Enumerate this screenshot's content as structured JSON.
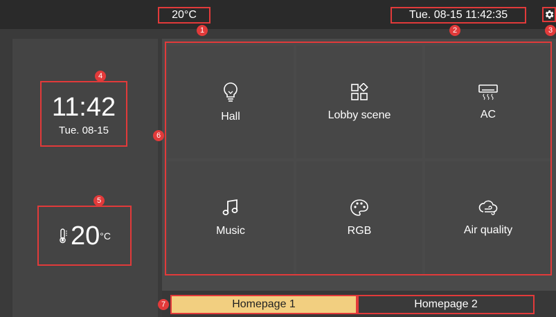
{
  "topbar": {
    "temperature": "20°C",
    "datetime": "Tue. 08-15 11:42:35"
  },
  "badges": [
    "1",
    "2",
    "3",
    "4",
    "5",
    "6",
    "7"
  ],
  "clock": {
    "time": "11:42",
    "date": "Tue. 08-15"
  },
  "weather": {
    "value": "20",
    "unit": "°C"
  },
  "tiles": [
    {
      "label": "Hall",
      "icon": "lightbulb-icon"
    },
    {
      "label": "Lobby scene",
      "icon": "scene-grid-icon"
    },
    {
      "label": "AC",
      "icon": "air-conditioner-icon"
    },
    {
      "label": "Music",
      "icon": "music-note-icon"
    },
    {
      "label": "RGB",
      "icon": "palette-icon"
    },
    {
      "label": "Air quality",
      "icon": "cloud-wind-icon"
    }
  ],
  "tabs": {
    "tab1": "Homepage 1",
    "tab2": "Homepage 2"
  },
  "colors": {
    "accent": "#e23a3a",
    "active_tab": "#f2cf80",
    "background": "#3a3a3a"
  }
}
